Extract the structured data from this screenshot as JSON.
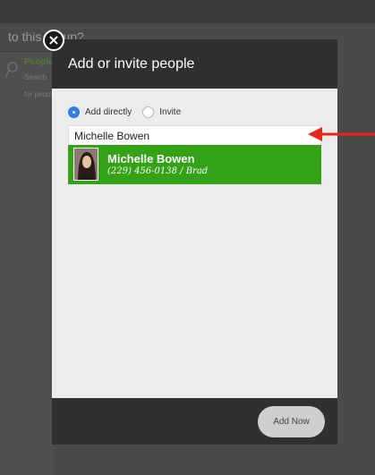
{
  "background": {
    "title": "to this group?",
    "people_label": "People",
    "sub_line1": "Search",
    "sub_line2": "for people"
  },
  "modal": {
    "title": "Add or invite people",
    "close_icon": "×",
    "radio": {
      "add_directly_label": "Add directly",
      "invite_label": "Invite",
      "selected": "add_directly"
    },
    "search": {
      "value": "Michelle Bowen",
      "placeholder": ""
    },
    "suggestion": {
      "name": "Michelle Bowen",
      "detail": "(229) 456-0138 / Brad"
    },
    "add_now_label": "Add Now"
  },
  "colors": {
    "suggestion_bg": "#34a217",
    "radio_selected": "#2f7fe3",
    "arrow": "#e8261c"
  },
  "icons": [
    "close-icon",
    "search-icon",
    "arrow-icon"
  ]
}
